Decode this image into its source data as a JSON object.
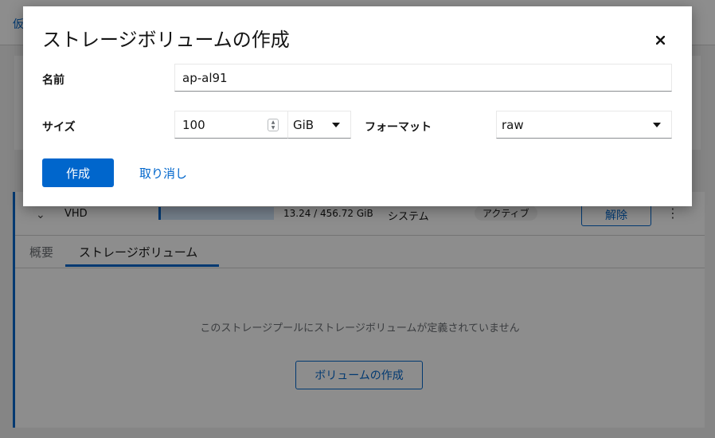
{
  "background": {
    "breadcrumb": "仮",
    "pool_row": {
      "name": "VHD",
      "usage_text": "13.24 / 456.72 GiB",
      "usage_fraction": 0.029,
      "type": "システム",
      "status": "アクティブ",
      "detach_label": "解除"
    },
    "tabs": [
      {
        "label": "概要",
        "active": false
      },
      {
        "label": "ストレージボリューム",
        "active": true
      }
    ],
    "empty_message": "このストレージプールにストレージボリュームが定義されていません",
    "create_volume_label": "ボリュームの作成"
  },
  "modal": {
    "title": "ストレージボリュームの作成",
    "close_icon": "close-icon",
    "name": {
      "label": "名前",
      "value": "ap-al91"
    },
    "size": {
      "label": "サイズ",
      "value": "100",
      "unit": "GiB",
      "unit_options": [
        "GiB"
      ]
    },
    "format": {
      "label": "フォーマット",
      "value": "raw"
    },
    "create_label": "作成",
    "cancel_label": "取り消し"
  },
  "colors": {
    "accent": "#0066cc",
    "text": "#151515"
  }
}
